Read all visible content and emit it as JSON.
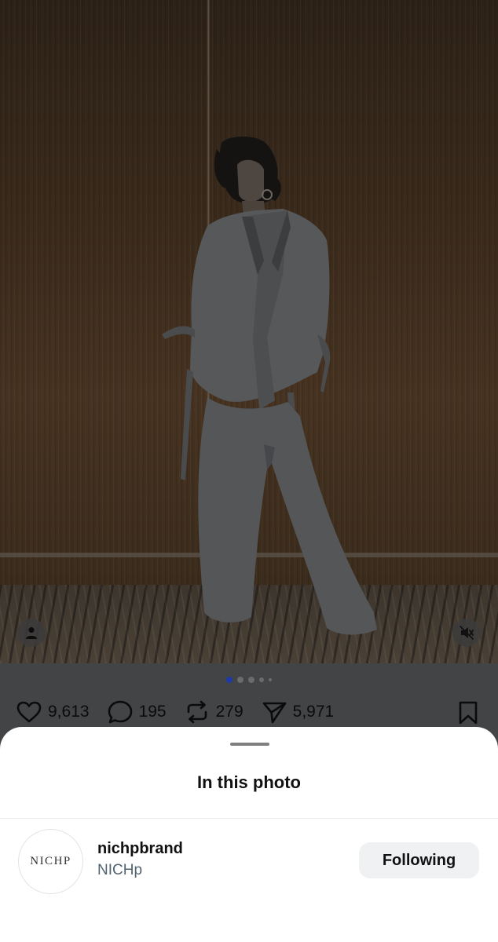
{
  "photo": {
    "icons": {
      "tag_people": "person-icon",
      "sound": "mute-icon"
    }
  },
  "carousel": {
    "active_index": 0
  },
  "actions": {
    "like_count": "9,613",
    "reply_count": "195",
    "repost_count": "279",
    "share_count": "5,971",
    "icons": [
      "heart-icon",
      "reply-icon",
      "repost-icon",
      "share-icon",
      "bookmark-icon"
    ]
  },
  "sheet": {
    "title": "In this photo",
    "people": [
      {
        "avatar_text": "NICHP",
        "handle": "nichpbrand",
        "name": "NICHp",
        "follow_label": "Following"
      }
    ]
  },
  "colors": {
    "sheet_background": "#ffffff",
    "follow_button_bg": "#eff1f3",
    "active_dot": "#1e3aa8",
    "dim_overlay": "#434446"
  }
}
